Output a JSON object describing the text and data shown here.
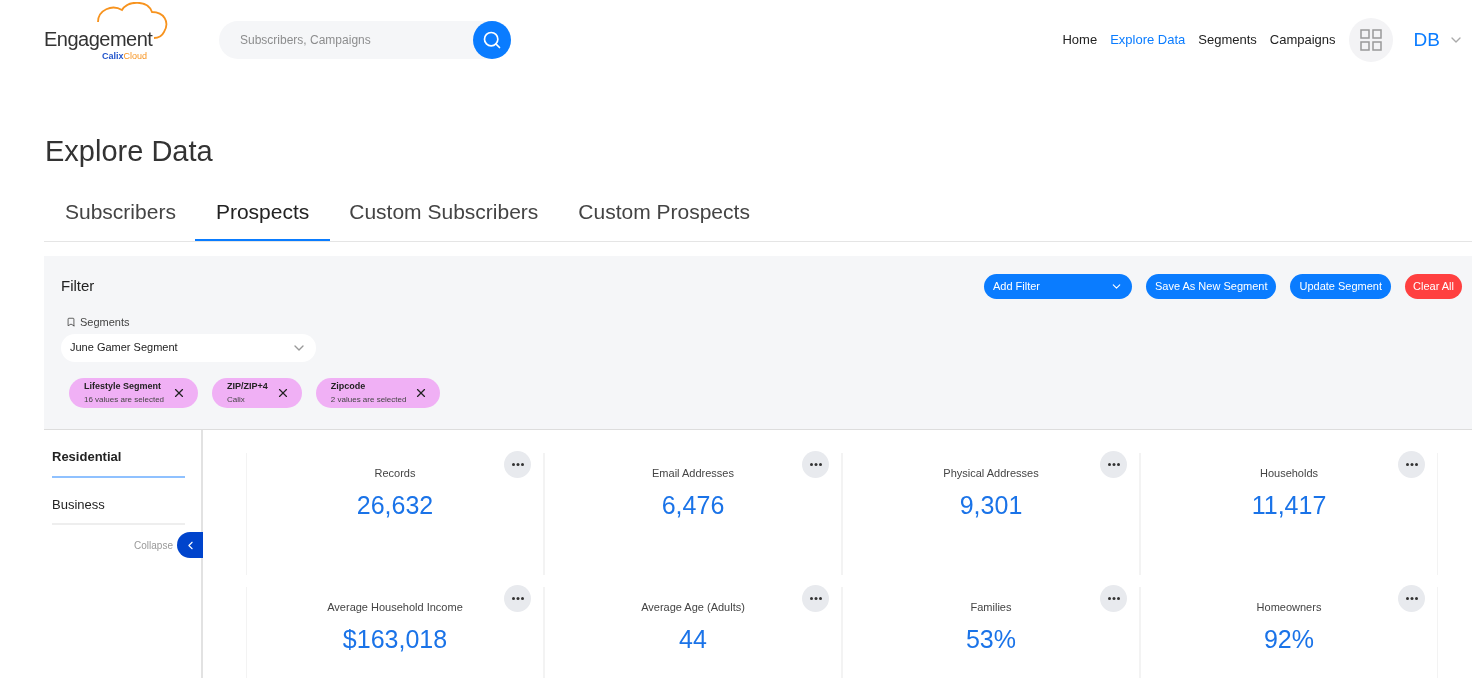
{
  "logo": {
    "name": "Engagement",
    "brand_a": "Calix",
    "brand_b": "Cloud"
  },
  "search": {
    "placeholder": "Subscribers, Campaigns"
  },
  "nav": [
    {
      "label": "Home",
      "selected": false
    },
    {
      "label": "Explore Data",
      "selected": true
    },
    {
      "label": "Segments",
      "selected": false
    },
    {
      "label": "Campaigns",
      "selected": false
    }
  ],
  "user": {
    "initials": "DB"
  },
  "page_title": "Explore Data",
  "tabs": [
    {
      "label": "Subscribers",
      "selected": false
    },
    {
      "label": "Prospects",
      "selected": true
    },
    {
      "label": "Custom Subscribers",
      "selected": false
    },
    {
      "label": "Custom Prospects",
      "selected": false
    }
  ],
  "filter": {
    "title": "Filter",
    "add_filter": "Add Filter",
    "save_new": "Save As New Segment",
    "update": "Update Segment",
    "clear": "Clear All",
    "segments_label": "Segments",
    "segment_value": "June Gamer Segment",
    "chips": [
      {
        "title": "Lifestyle Segment",
        "detail": "16 values are selected"
      },
      {
        "title": "ZIP/ZIP+4",
        "detail": "Calix"
      },
      {
        "title": "Zipcode",
        "detail": "2 values are selected"
      }
    ]
  },
  "sidebar": {
    "items": [
      {
        "label": "Residential",
        "selected": true
      },
      {
        "label": "Business",
        "selected": false
      }
    ],
    "collapse": "Collapse"
  },
  "metrics": [
    {
      "label": "Records",
      "value": "26,632"
    },
    {
      "label": "Email Addresses",
      "value": "6,476"
    },
    {
      "label": "Physical Addresses",
      "value": "9,301"
    },
    {
      "label": "Households",
      "value": "11,417"
    },
    {
      "label": "Average Household Income",
      "value": "$163,018"
    },
    {
      "label": "Average Age (Adults)",
      "value": "44"
    },
    {
      "label": "Families",
      "value": "53%"
    },
    {
      "label": "Homeowners",
      "value": "92%"
    }
  ]
}
